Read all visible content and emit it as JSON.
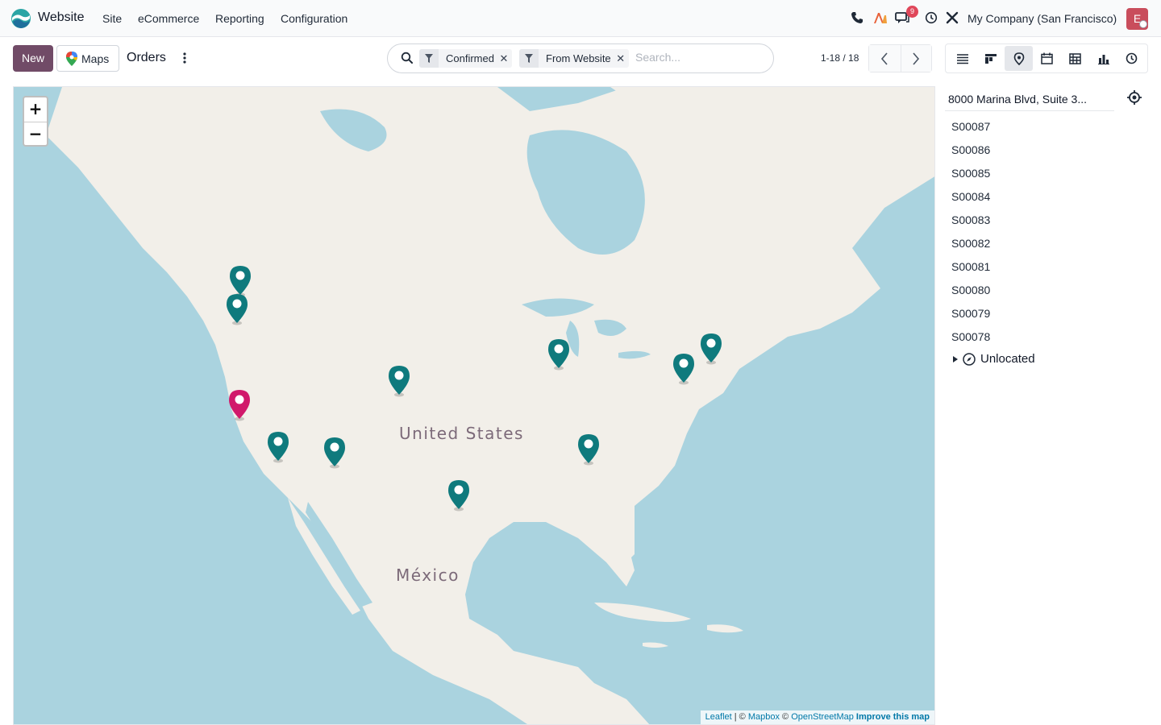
{
  "navbar": {
    "app_name": "Website",
    "menu": [
      "Site",
      "eCommerce",
      "Reporting",
      "Configuration"
    ],
    "notification_count": "9",
    "company": "My Company (San Francisco)",
    "avatar_letter": "E"
  },
  "control_panel": {
    "new_label": "New",
    "maps_label": "Maps",
    "title": "Orders",
    "search": {
      "facets": [
        "Confirmed",
        "From Website"
      ],
      "placeholder": "Search..."
    },
    "pager": "1-18 / 18",
    "views": [
      "list",
      "kanban",
      "map",
      "calendar",
      "pivot",
      "graph",
      "activity"
    ],
    "active_view": "map"
  },
  "map": {
    "labels": {
      "country_us": "United States",
      "country_mx": "México"
    },
    "zoom_in": "+",
    "zoom_out": "−",
    "attribution": {
      "leaflet": "Leaflet",
      "sep1": " | © ",
      "mapbox": "Mapbox",
      "sep2": " © ",
      "osm": "OpenStreetMap",
      "improve": "Improve this map"
    },
    "colors": {
      "marker": "#0f7a7d",
      "marker_selected": "#d1196b",
      "water": "#aad3df",
      "land": "#f2efe9"
    }
  },
  "sidebar": {
    "address": "8000 Marina Blvd, Suite 3...",
    "records": [
      "S00087",
      "S00086",
      "S00085",
      "S00084",
      "S00083",
      "S00082",
      "S00081",
      "S00080",
      "S00079",
      "S00078"
    ],
    "unlocated_label": "Unlocated"
  }
}
